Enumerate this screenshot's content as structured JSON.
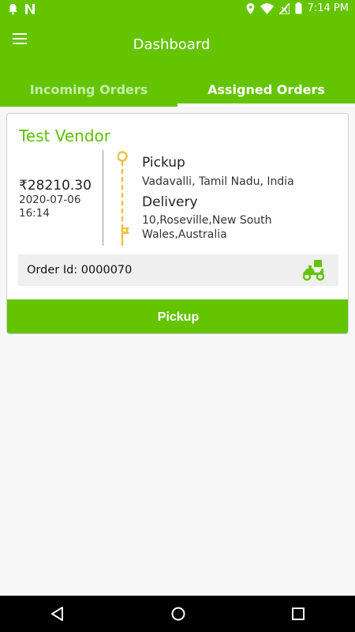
{
  "status_bar": {
    "time": "7:14 PM"
  },
  "app_bar": {
    "title": "Dashboard"
  },
  "tabs": [
    {
      "label": "Incoming Orders",
      "active": false
    },
    {
      "label": "Assigned Orders",
      "active": true
    }
  ],
  "order": {
    "vendor": "Test Vendor",
    "price": "₹28210.30",
    "date": "2020-07-06",
    "time": "16:14",
    "pickup_label": "Pickup",
    "pickup_address": "Vadavalli, Tamil Nadu, India",
    "delivery_label": "Delivery",
    "delivery_address": "10,Roseville,New South Wales,Australia",
    "order_id_text": "Order Id: 0000070",
    "action_label": "Pickup"
  },
  "colors": {
    "primary": "#64c400",
    "route_line": "#f0c040"
  },
  "icons": [
    "menu-icon",
    "scooter-icon",
    "back-icon",
    "home-icon",
    "recents-icon"
  ]
}
